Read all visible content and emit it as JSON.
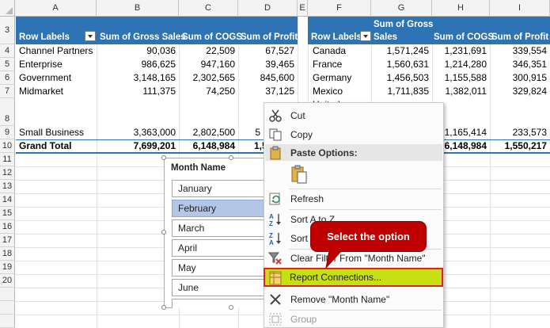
{
  "colors": {
    "pivot_header": "#2e74b5",
    "slicer_selected": "#b4c6e7",
    "highlight_fill": "#c6e014",
    "highlight_border": "#e2231a",
    "callout_fill": "#c00000"
  },
  "columns": [
    "A",
    "B",
    "C",
    "D",
    "E",
    "F",
    "G",
    "H",
    "I"
  ],
  "rows": [
    "3",
    "4",
    "5",
    "6",
    "7",
    "8",
    "9",
    "10",
    "11",
    "12",
    "13",
    "14",
    "15",
    "16",
    "17",
    "18",
    "19",
    "20"
  ],
  "pivot1": {
    "row_labels": "Row Labels",
    "col1": "Sum of Gross Sales",
    "col2": "Sum of COGS",
    "col3": "Sum of Profit",
    "r1": {
      "label": "Channel Partners",
      "gross": "90,036",
      "cogs": "22,509",
      "profit": "67,527"
    },
    "r2": {
      "label": "Enterprise",
      "gross": "986,625",
      "cogs": "947,160",
      "profit": "39,465"
    },
    "r3": {
      "label": "Government",
      "gross": "3,148,165",
      "cogs": "2,302,565",
      "profit": "845,600"
    },
    "r4": {
      "label": "Midmarket",
      "gross": "111,375",
      "cogs": "74,250",
      "profit": "37,125"
    },
    "r5": {
      "label": "Small Business",
      "gross": "3,363,000",
      "cogs": "2,802,500",
      "profit": "5"
    },
    "total": {
      "label": "Grand Total",
      "gross": "7,699,201",
      "cogs": "6,148,984",
      "profit": "1,5"
    }
  },
  "pivot2": {
    "row_labels": "Row Labels",
    "col1_line1": "Sum of Gross",
    "col1_line2": "Sales",
    "col2": "Sum of COGS",
    "col3": "Sum of Profit",
    "r1": {
      "label": "Canada",
      "gross": "1,571,245",
      "cogs": "1,231,691",
      "profit": "339,554"
    },
    "r2": {
      "label": "France",
      "gross": "1,560,631",
      "cogs": "1,214,280",
      "profit": "346,351"
    },
    "r3": {
      "label": "Germany",
      "gross": "1,456,503",
      "cogs": "1,155,588",
      "profit": "300,915"
    },
    "r4": {
      "label": "Mexico",
      "gross": "1,711,835",
      "cogs": "1,382,011",
      "profit": "329,824"
    },
    "r4b": {
      "label": "United"
    },
    "r5": {
      "cogs": "1,165,414",
      "profit": "233,573"
    },
    "total": {
      "cogs": "6,148,984",
      "profit": "1,550,217"
    }
  },
  "slicer": {
    "title": "Month Name",
    "items": [
      "January",
      "February",
      "March",
      "April",
      "May",
      "June"
    ],
    "selected": "February"
  },
  "menu": {
    "cut": "Cut",
    "copy": "Copy",
    "paste_options": "Paste Options:",
    "refresh": "Refresh",
    "sort_az": "Sort A to Z",
    "sort_za": "Sort",
    "clear_filter": "Clear Filter From \"Month Name\"",
    "report_connections": "Report Connections...",
    "remove": "Remove \"Month Name\"",
    "group": "Group"
  },
  "callout": {
    "text": "Select the option"
  },
  "icons": {
    "cut": "scissors-icon",
    "copy": "copy-icon",
    "paste": "clipboard-icon",
    "refresh": "refresh-icon",
    "sort_az": "sort-ascending-icon",
    "sort_za": "sort-descending-icon",
    "clear_filter": "clear-filter-icon",
    "report_connections": "report-connections-icon",
    "remove": "close-x-icon",
    "group": "group-icon"
  }
}
